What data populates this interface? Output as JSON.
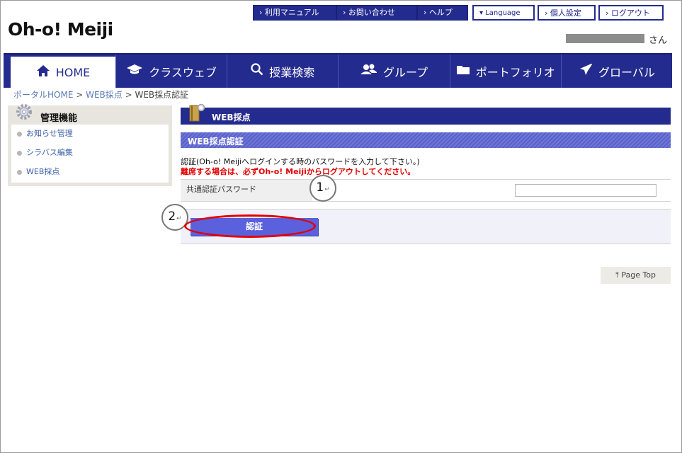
{
  "header": {
    "logo": "Oh-o! Meiji",
    "suffix": "さん",
    "links": {
      "manual": "› 利用マニュアル",
      "contact": "› お問い合わせ",
      "help": "› ヘルプ",
      "language": "▾ Language",
      "profile": "› 個人設定",
      "logout": "› ログアウト"
    }
  },
  "nav": {
    "home": "HOME",
    "classweb": "クラスウェブ",
    "search": "授業検索",
    "group": "グループ",
    "portfolio": "ポートフォリオ",
    "global": "グローバル"
  },
  "breadcrumb": {
    "home": "ポータルHOME",
    "sep": " > ",
    "web": "WEB採点",
    "current": "WEB採点認証"
  },
  "sidebar": {
    "title": "管理機能",
    "items": [
      "お知らせ管理",
      "シラバス編集",
      "WEB採点"
    ]
  },
  "main": {
    "title": "WEB採点",
    "subtitle": "WEB採点認証",
    "message": "認証(Oh-o! Meijiへログインする時のパスワードを入力して下さい。)",
    "warning": "離席する場合は、必ずOh-o! Meijiからログアウトしてください。",
    "password_label": "共通認証パスワード",
    "password_value": "",
    "auth_button": "認証",
    "page_top": "⤒ Page Top"
  },
  "annotations": {
    "one": "1",
    "two": "2",
    "ret": "↵"
  },
  "colors": {
    "primary": "#242b8e",
    "button": "#5b60dd",
    "warning": "#e40000"
  }
}
